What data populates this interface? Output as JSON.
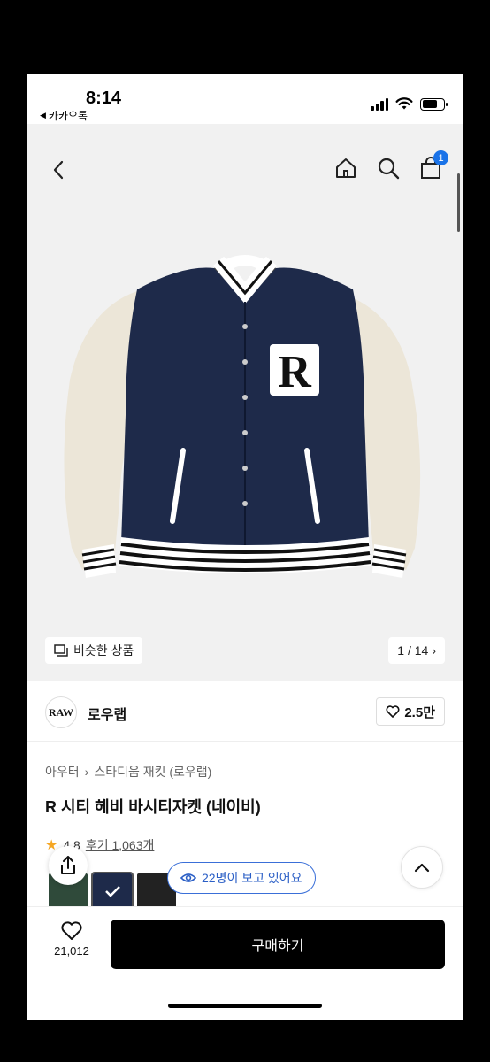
{
  "status_bar": {
    "time": "8:14",
    "back_app": "카카오톡"
  },
  "nav": {
    "back_icon": "chevron-left-icon",
    "home_icon": "home-icon",
    "search_icon": "search-icon",
    "cart_icon": "bag-icon",
    "cart_count": "1"
  },
  "hero": {
    "similar_label": "비슷한 상품",
    "counter": "1 / 14"
  },
  "brand": {
    "logo_text": "RAW",
    "name": "로우랩",
    "likes": "2.5만"
  },
  "product": {
    "breadcrumb": [
      "아우터",
      "스타디움 재킷 (로우랩)"
    ],
    "title": "R 시티 헤비 바시티자켓 (네이비)",
    "rating": "4.8",
    "reviews": "후기 1,063개"
  },
  "floating": {
    "viewers": "22명이 보고 있어요"
  },
  "bottom": {
    "wish_count": "21,012",
    "buy_label": "구매하기"
  },
  "colors": {
    "accent": "#1a73e8",
    "navy": "#1e2a4a",
    "cream": "#ece6d8"
  }
}
